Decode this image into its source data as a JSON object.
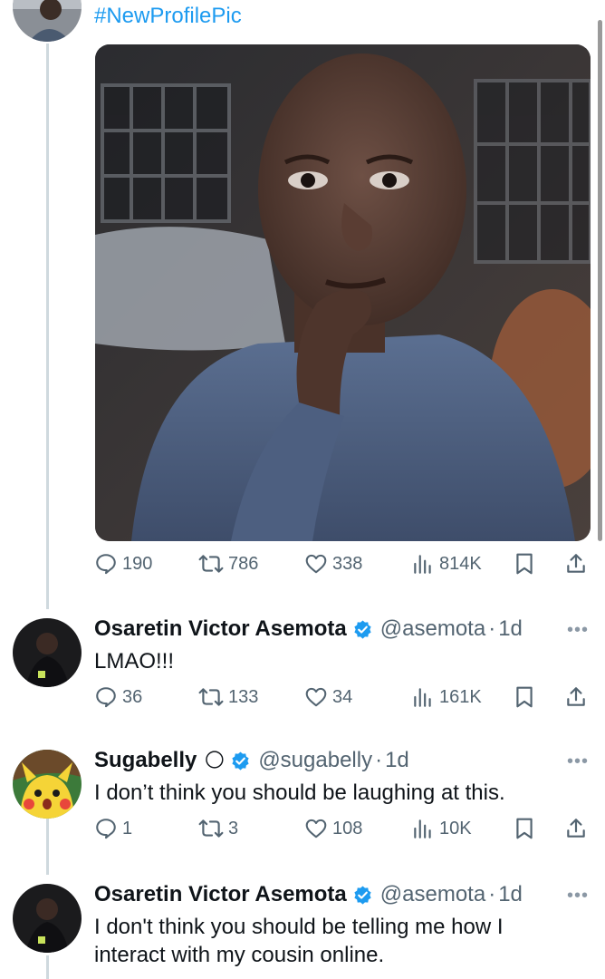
{
  "original_post": {
    "text": "#NewProfilePic",
    "stats": {
      "replies": "190",
      "reposts": "786",
      "likes": "338",
      "views": "814K"
    }
  },
  "replies": [
    {
      "name": "Osaretin Victor Asemota",
      "handle": "@asemota",
      "dot": "·",
      "time": "1d",
      "text": "LMAO!!!",
      "stats": {
        "replies": "36",
        "reposts": "133",
        "likes": "34",
        "views": "161K"
      }
    },
    {
      "name": "Sugabelly",
      "emoji": "🌕",
      "handle": "@sugabelly",
      "dot": "·",
      "time": "1d",
      "text": "I don’t think you should be laughing at this.",
      "stats": {
        "replies": "1",
        "reposts": "3",
        "likes": "108",
        "views": "10K"
      }
    },
    {
      "name": "Osaretin Victor Asemota",
      "handle": "@asemota",
      "dot": "·",
      "time": "1d",
      "text": "I don't think you should be telling me how I interact with my cousin online."
    }
  ],
  "more_label": "•••",
  "colors": {
    "accent": "#1d9bf0",
    "verified": "#1d9bf0",
    "muted": "#536471",
    "thread_line": "#cfd9de"
  },
  "icons": [
    "reply-icon",
    "repost-icon",
    "like-icon",
    "views-icon",
    "bookmark-icon",
    "share-icon",
    "verified-badge-icon"
  ]
}
